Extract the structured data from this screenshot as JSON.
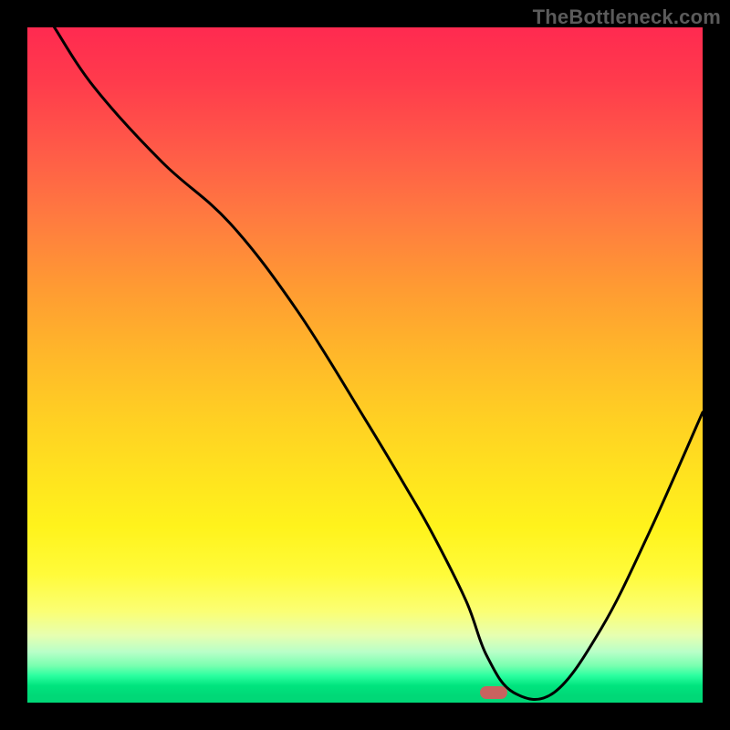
{
  "watermark": "TheBottleneck.com",
  "colors": {
    "frame": "#000000",
    "curve": "#000000",
    "marker": "#c9625f"
  },
  "chart_data": {
    "type": "line",
    "title": "",
    "xlabel": "",
    "ylabel": "",
    "xlim": [
      0,
      100
    ],
    "ylim": [
      0,
      100
    ],
    "grid": false,
    "note": "No numeric axes are drawn; values are relative percentages of the plot area estimated from the curve shape.",
    "series": [
      {
        "name": "bottleneck-curve",
        "x": [
          4,
          10,
          20,
          30,
          40,
          50,
          56,
          60,
          65,
          68,
          72,
          78,
          85,
          92,
          100
        ],
        "values": [
          100,
          91,
          80,
          71,
          58,
          42,
          32,
          25,
          15,
          7,
          1.5,
          1.5,
          11,
          25,
          43
        ]
      }
    ],
    "marker": {
      "x": 69,
      "y": 1.5,
      "label": ""
    },
    "background_gradient": {
      "orientation": "vertical",
      "stops": [
        {
          "pct": 0,
          "color": "#ff2a50"
        },
        {
          "pct": 50,
          "color": "#ffd023"
        },
        {
          "pct": 85,
          "color": "#fffb3a"
        },
        {
          "pct": 100,
          "color": "#00d877"
        }
      ]
    }
  }
}
